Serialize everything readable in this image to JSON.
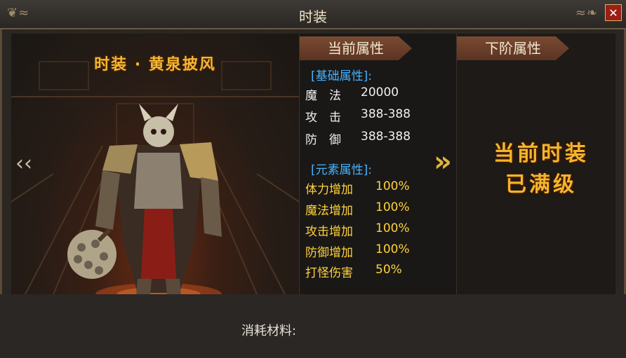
{
  "window": {
    "title": "时装",
    "close_label": "✕"
  },
  "character": {
    "name": "时装 · 黄泉披风"
  },
  "current": {
    "tab_label": "当前属性",
    "base_section": "[基础属性]:",
    "base_attrs": [
      {
        "key": "魔　法",
        "value": "20000"
      },
      {
        "key": "攻　击",
        "value": "388-388"
      },
      {
        "key": "防　御",
        "value": "388-388"
      }
    ],
    "element_section": "[元素属性]:",
    "element_attrs": [
      {
        "key": "体力增加",
        "value": "100%"
      },
      {
        "key": "魔法增加",
        "value": "100%"
      },
      {
        "key": "攻击增加",
        "value": "100%"
      },
      {
        "key": "防御增加",
        "value": "100%"
      },
      {
        "key": "打怪伤害",
        "value": "50%"
      }
    ]
  },
  "next": {
    "tab_label": "下阶属性",
    "max_line1": "当前时装",
    "max_line2": "已满级"
  },
  "materials": {
    "label": "消耗材料:"
  },
  "icons": {
    "left": "chevron-left-icon",
    "right": "double-chevron-right-icon",
    "close": "close-icon"
  },
  "colors": {
    "gold": "#f3b734",
    "section_blue": "#46b2ff",
    "element_yellow": "#ffd23c"
  }
}
